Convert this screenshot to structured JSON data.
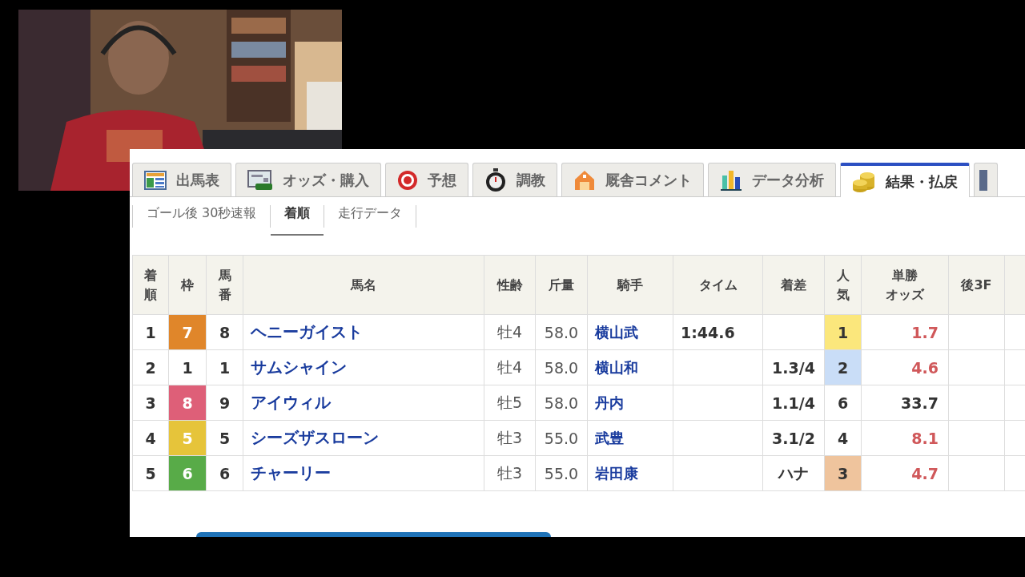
{
  "tabs": [
    {
      "kind": "tab",
      "label": "出馬表",
      "selected": false
    },
    {
      "kind": "tab",
      "label": "オッズ・購入",
      "selected": false
    },
    {
      "kind": "tab",
      "label": "予想",
      "selected": false
    },
    {
      "kind": "tab",
      "label": "調教",
      "selected": false
    },
    {
      "kind": "tab",
      "label": "厩舎コメント",
      "selected": false
    },
    {
      "kind": "tab",
      "label": "データ分析",
      "selected": false
    },
    {
      "kind": "tab",
      "label": "結果・払戻",
      "selected": true
    },
    {
      "kind": "partial",
      "selected": false
    }
  ],
  "subtabs": [
    {
      "label": "ゴール後 30秒速報",
      "selected": false
    },
    {
      "label": "着順",
      "selected": true
    },
    {
      "label": "走行データ",
      "selected": false
    }
  ],
  "table": {
    "columns": [
      "着順",
      "枠",
      "馬番",
      "馬名",
      "性齢",
      "斤量",
      "騎手",
      "タイム",
      "着差",
      "人気",
      [
        "単勝",
        "オッズ"
      ],
      "後3F"
    ],
    "rows": [
      {
        "rank": "1",
        "frame": {
          "number": "7",
          "color": "#e0862a"
        },
        "number": "8",
        "horse": "ヘニーガイスト",
        "sex_age": "牡4",
        "weight": "58.0",
        "jockey": "横山武",
        "time": "1:44.6",
        "popularity": {
          "number": "1",
          "color": "#fbe77c"
        },
        "odds": "1.7",
        "odds_hot": true
      },
      {
        "rank": "2",
        "frame": {
          "number": "1",
          "color": "#ffffff"
        },
        "number": "1",
        "horse": "サムシャイン",
        "sex_age": "牡4",
        "weight": "58.0",
        "jockey": "横山和",
        "margin": "1.3/4",
        "popularity": {
          "number": "2",
          "color": "#c9ddf7"
        },
        "odds": "4.6",
        "odds_hot": true
      },
      {
        "rank": "3",
        "frame": {
          "number": "8",
          "color": "#de5f78"
        },
        "number": "9",
        "horse": "アイウィル",
        "sex_age": "牡5",
        "weight": "58.0",
        "jockey": "丹内",
        "margin": "1.1/4",
        "popularity": {
          "number": "6"
        },
        "odds": "33.7",
        "odds_hot": false
      },
      {
        "rank": "4",
        "frame": {
          "number": "5",
          "color": "#e6c43a"
        },
        "number": "5",
        "horse": "シーズザスローン",
        "sex_age": "牡3",
        "weight": "55.0",
        "jockey": "武豊",
        "margin": "3.1/2",
        "popularity": {
          "number": "4"
        },
        "odds": "8.1",
        "odds_hot": true
      },
      {
        "rank": "5",
        "frame": {
          "number": "6",
          "color": "#58ab48"
        },
        "number": "6",
        "horse": "チャーリー",
        "sex_age": "牡3",
        "weight": "55.0",
        "jockey": "岩田康",
        "margin": "ハナ",
        "popularity": {
          "number": "3",
          "color": "#efc49d"
        },
        "odds": "4.7",
        "odds_hot": true
      }
    ]
  }
}
